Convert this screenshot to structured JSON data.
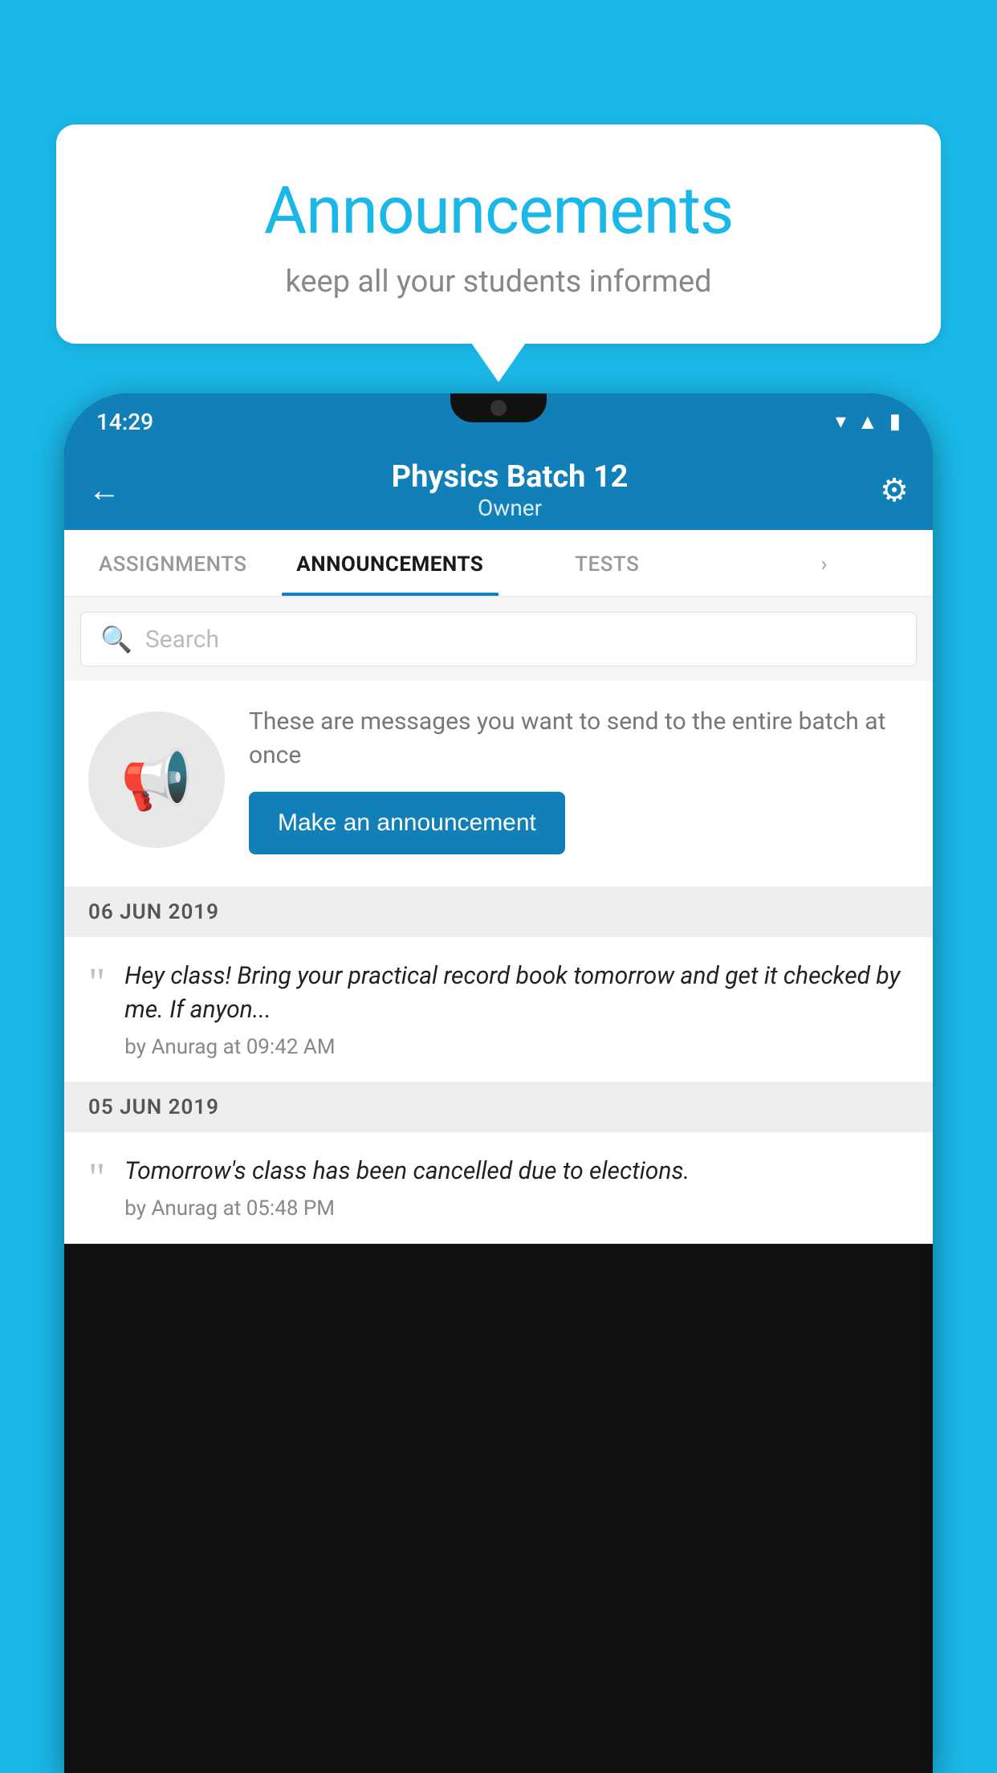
{
  "bubble": {
    "title": "Announcements",
    "subtitle": "keep all your students informed"
  },
  "appBar": {
    "title": "Physics Batch 12",
    "subtitle": "Owner",
    "backArrow": "←",
    "gearIcon": "⚙"
  },
  "tabs": [
    {
      "label": "ASSIGNMENTS",
      "active": false
    },
    {
      "label": "ANNOUNCEMENTS",
      "active": true
    },
    {
      "label": "TESTS",
      "active": false
    },
    {
      "label": "›",
      "active": false,
      "partial": true
    }
  ],
  "search": {
    "placeholder": "Search"
  },
  "promo": {
    "text": "These are messages you want to send to the entire batch at once",
    "buttonLabel": "Make an announcement"
  },
  "statusBar": {
    "time": "14:29"
  },
  "announcements": [
    {
      "date": "06  JUN  2019",
      "text": "Hey class! Bring your practical record book tomorrow and get it checked by me. If anyon...",
      "meta": "by Anurag at 09:42 AM"
    },
    {
      "date": "05  JUN  2019",
      "text": "Tomorrow's class has been cancelled due to elections.",
      "meta": "by Anurag at 05:48 PM"
    }
  ]
}
